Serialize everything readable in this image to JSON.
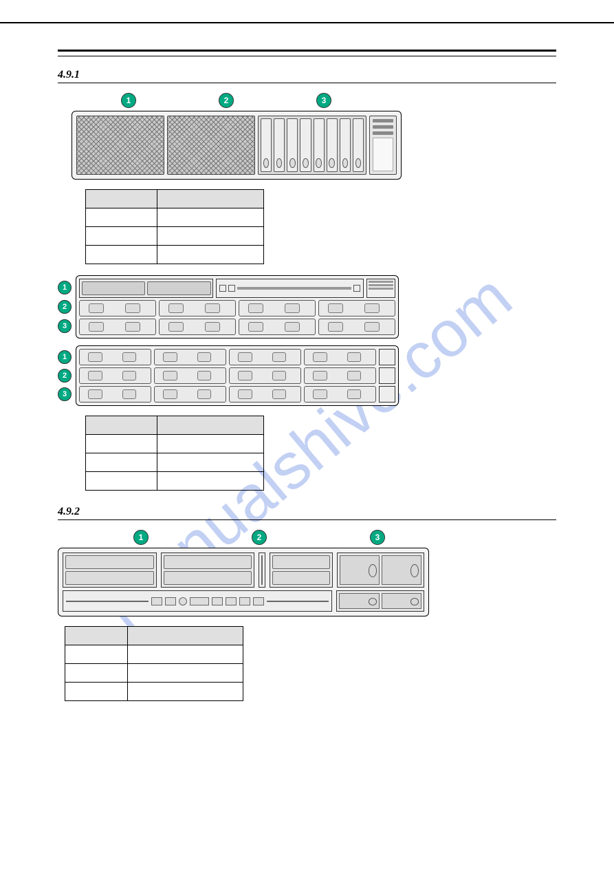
{
  "section_label": "",
  "subsections": {
    "s491": "4.9.1",
    "s492": "4.9.2"
  },
  "callouts": {
    "one": "1",
    "two": "2",
    "three": "3"
  },
  "table1": {
    "h1": "",
    "h2": "",
    "rows": [
      {
        "a": "",
        "b": ""
      },
      {
        "a": "",
        "b": ""
      },
      {
        "a": "",
        "b": ""
      }
    ]
  },
  "table2": {
    "h1": "",
    "h2": "",
    "rows": [
      {
        "a": "",
        "b": ""
      },
      {
        "a": "",
        "b": ""
      },
      {
        "a": "",
        "b": ""
      }
    ]
  },
  "table3": {
    "h1": "",
    "h2": "",
    "rows": [
      {
        "a": "",
        "b": ""
      },
      {
        "a": "",
        "b": ""
      },
      {
        "a": "",
        "b": ""
      }
    ]
  },
  "watermark": "manualshive.com"
}
